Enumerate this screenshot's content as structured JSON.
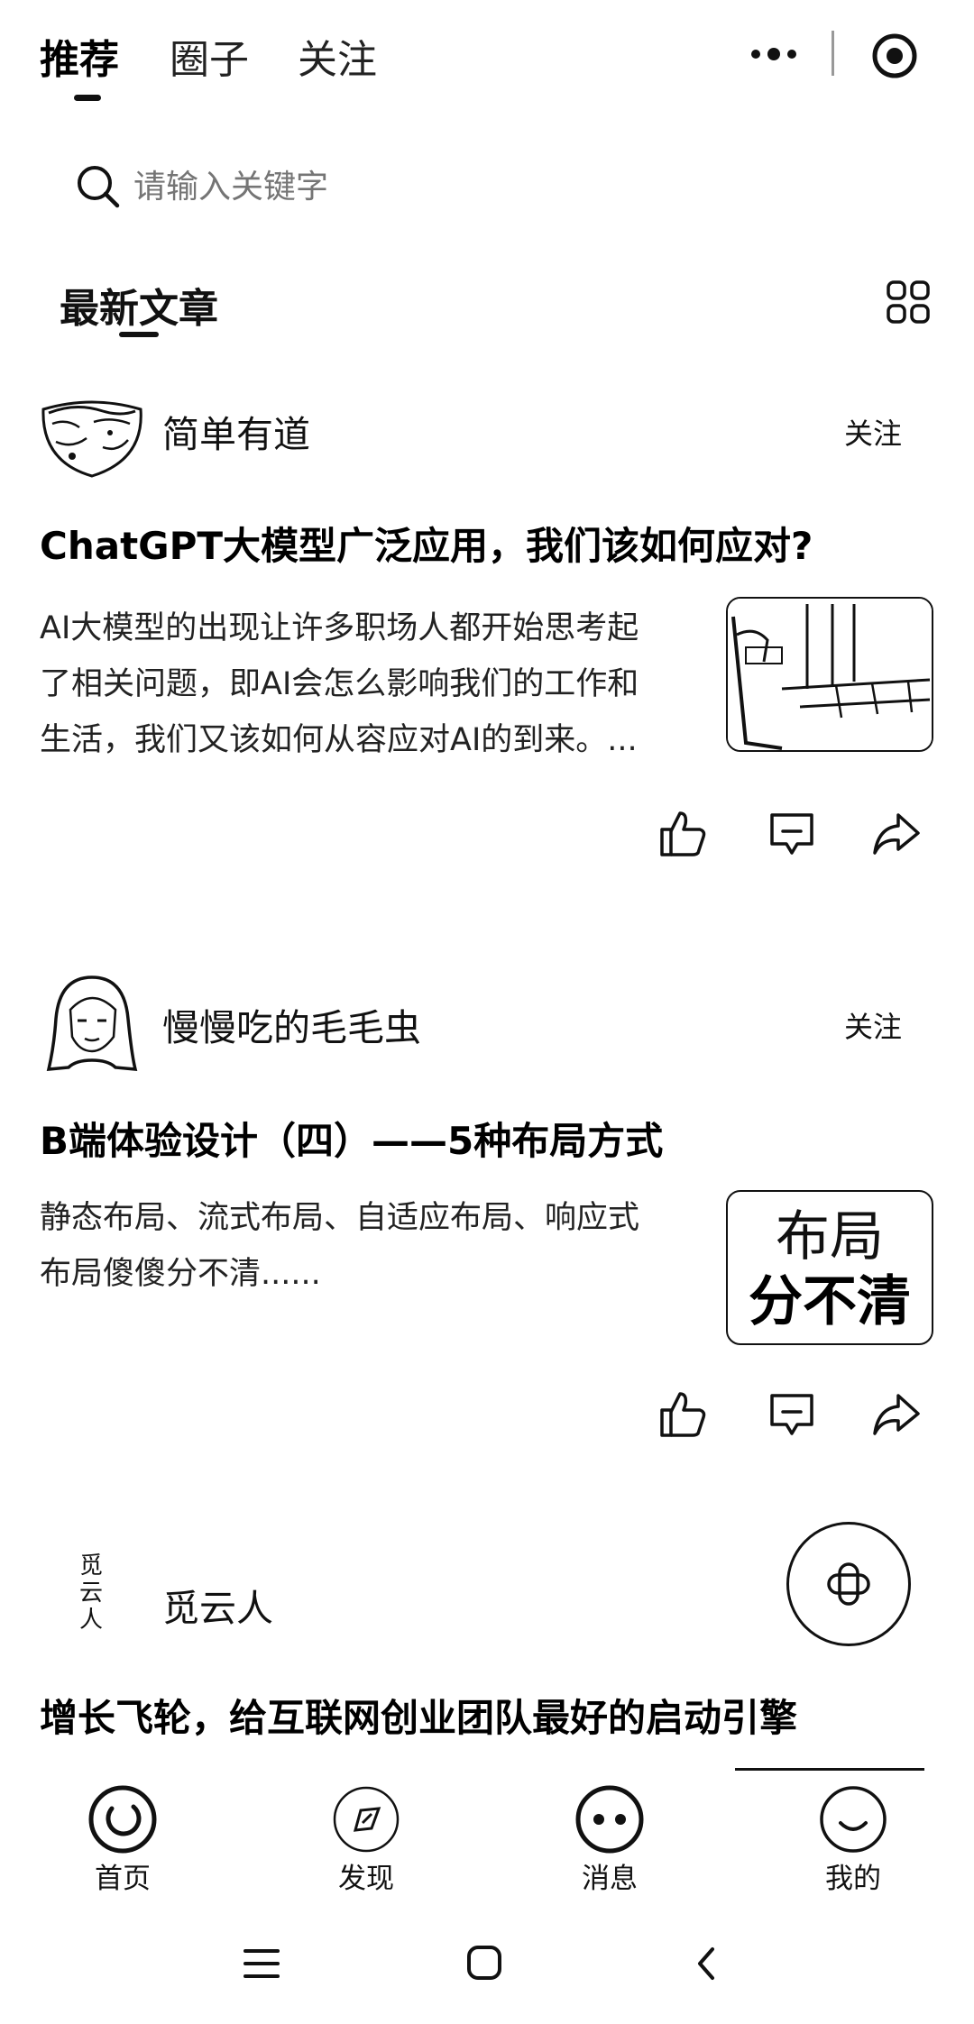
{
  "header": {
    "tabs": [
      {
        "label": "推荐",
        "active": true
      },
      {
        "label": "圈子",
        "active": false
      },
      {
        "label": "关注",
        "active": false
      }
    ],
    "more_icon": "more-dots-icon",
    "target_icon": "target-icon"
  },
  "search": {
    "placeholder": "请输入关键字",
    "icon": "search-icon"
  },
  "section": {
    "title": "最新文章",
    "grid_icon": "grid-icon"
  },
  "articles": [
    {
      "author": "简单有道",
      "follow": "关注",
      "title": "ChatGPT大模型广泛应用，我们该如何应对?",
      "summary_lines": [
        "AI大模型的出现让许多职场人都开始思考起",
        "了相关问题，即AI会怎么影响我们的工作和",
        "生活，我们又该如何从容应对AI的到来。..."
      ]
    },
    {
      "author": "慢慢吃的毛毛虫",
      "follow": "关注",
      "title": "B端体验设计（四）——5种布局方式",
      "summary_lines": [
        "静态布局、流式布局、自适应布局、响应式",
        "布局傻傻分不清......"
      ],
      "thumb_text": {
        "line1": "布局",
        "line2": "分不清"
      }
    },
    {
      "author": "觅云人",
      "avatar_text": "觅云人",
      "title": "增长飞轮，给互联网创业团队最好的启动引擎"
    }
  ],
  "bottom_nav": [
    {
      "label": "首页",
      "icon": "home-smile-icon"
    },
    {
      "label": "发现",
      "icon": "discover-icon"
    },
    {
      "label": "消息",
      "icon": "message-icon"
    },
    {
      "label": "我的",
      "icon": "profile-smile-icon"
    }
  ],
  "system_nav": [
    "menu-icon",
    "home-square-icon",
    "back-chevron-icon"
  ]
}
